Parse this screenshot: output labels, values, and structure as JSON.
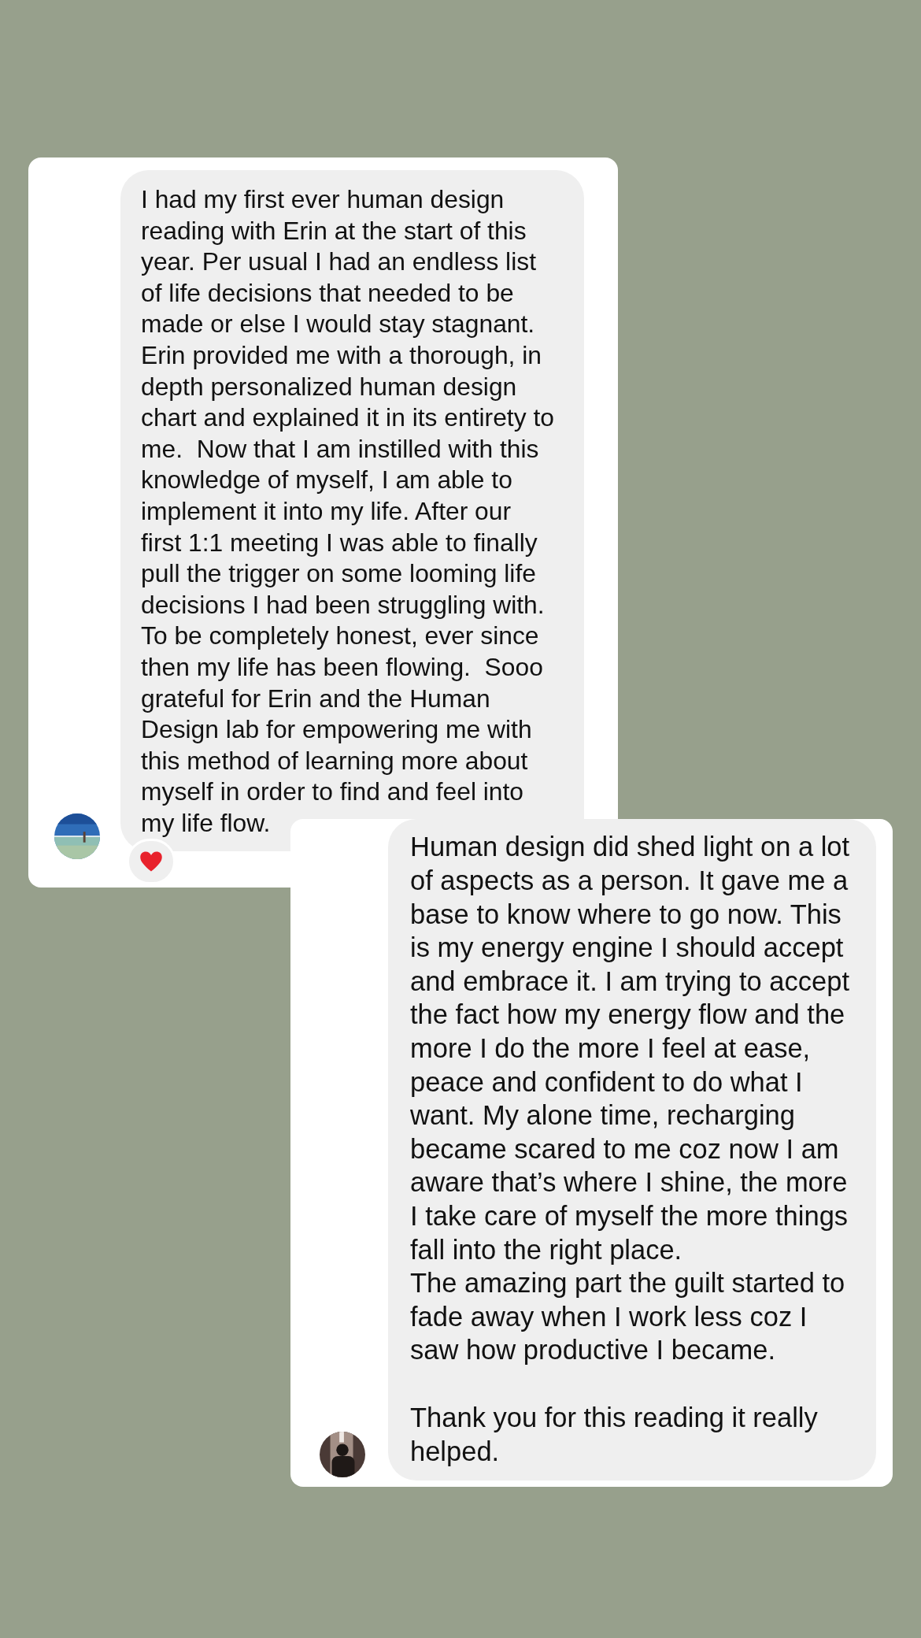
{
  "messages": [
    {
      "reacted": true,
      "paragraphs": [
        "I had my first ever human design reading with Erin at the start of this year. Per usual I had an endless list of life decisions that needed to be made or else I would stay stagnant. Erin provided me with a thorough, in depth personalized human design chart and explained it in its entirety to me.  Now that I am instilled with this knowledge of myself, I am able to implement it into my life. After our first 1:1 meeting I was able to finally pull the trigger on some looming life decisions I had been struggling with. To be completely honest, ever since then my life has been flowing.  Sooo grateful for Erin and the Human Design lab for empowering me with this method of learning more about myself in order to find and feel into my life flow."
      ]
    },
    {
      "reacted": false,
      "paragraphs": [
        "Human design did shed light on a lot of aspects as a person. It gave me a base to know where to go now. This is my energy engine I should accept and embrace it. I am trying to accept the fact how my energy flow and the more I do the more I feel at ease, peace and confident to do what I want. My alone time, recharging became scared to me coz now I am aware that’s where I shine, the more I take care of myself the more things fall into the right place.",
        "The amazing part the guilt started to fade away when I work less coz I saw how productive I became.",
        "Thank you for this reading it really helped."
      ]
    }
  ]
}
